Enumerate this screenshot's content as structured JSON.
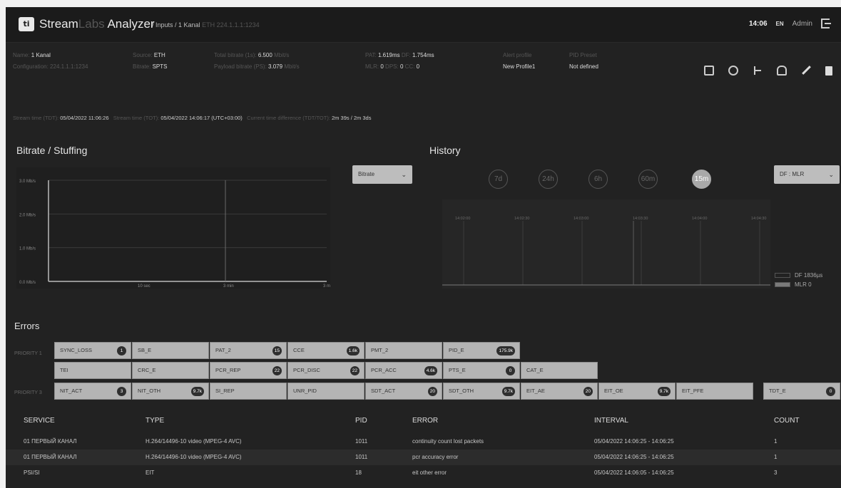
{
  "header": {
    "logo_text": "ti",
    "app_name_1": "Stream",
    "app_name_2": "Labs",
    "app_name_3": " Analyzer",
    "breadcrumb": "/ Inputs / 1 Kanal",
    "breadcrumb_dim": "ETH 224.1.1.1:1234",
    "time": "14:06",
    "lang": "EN",
    "user": "Admin"
  },
  "info": {
    "name_label": "Name:",
    "name_value": "1 Kanal",
    "config_label": "Configuration:",
    "config_value": "224.1.1.1:1234",
    "source_label": "Source:",
    "source_value": "ETH",
    "bitrate_label": "Bitrate:",
    "bitrate_value": "SPTS",
    "total_bitrate_label": "Total bitrate (1s):",
    "total_bitrate_value": "6.500",
    "total_bitrate_unit": "Mbit/s",
    "payload_label": "Payload bitrate (PS):",
    "payload_value": "3.079",
    "payload_unit": "Mbit/s",
    "pat_label": "PAT:",
    "pat_value": "1.619ms",
    "df_label": "DF:",
    "df_value": "1.754ms",
    "mlr_label": "MLR:",
    "mlr_value": "0",
    "dps_label": "DPS:",
    "dps_value": "0",
    "cc_label": "CC:",
    "cc_value": "0",
    "alert_label": "Alert profile",
    "alert_value": "New Profile1",
    "pid_label": "PID Preset",
    "pid_value": "Not defined"
  },
  "stream_line": {
    "t1_label": "Stream time (TDT):",
    "t1_value": "05/04/2022 11:06:26",
    "t2_label": "Stream time (TOT):",
    "t2_value": "05/04/2022 14:06:17 (UTC+03:00)",
    "diff_label": "Current time difference (TDT/TOT):",
    "diff_value": "2m 39s / 2m 3ds"
  },
  "bitrate_panel": {
    "title": "Bitrate / Stuffing",
    "select": "Bitrate"
  },
  "history_panel": {
    "title": "History",
    "ranges": [
      "7d",
      "24h",
      "6h",
      "60m",
      "15m"
    ],
    "active_range": "15m",
    "select": "DF : MLR",
    "legend": [
      {
        "label": "DF 1836µs",
        "color": "#222222"
      },
      {
        "label": "MLR 0",
        "color": "#7a7a7a"
      }
    ]
  },
  "chart_data": [
    {
      "type": "line",
      "y_tick_labels": [
        "3.0 Mb/s",
        "2.0 Mb/s",
        "1.0 Mb/s",
        "0.0 Mb/s"
      ],
      "x_tick_labels": [
        "10 sec",
        "3 min",
        "3 min"
      ],
      "series": [
        {
          "values": []
        }
      ]
    },
    {
      "type": "bar",
      "x_tick_labels": [
        "14:02:00",
        "14:02:30",
        "14:03:00",
        "14:03:30",
        "14:04:00",
        "14:04:30"
      ],
      "series": [
        {
          "name": "DF 1836µs",
          "values": []
        },
        {
          "name": "MLR 0",
          "values": []
        }
      ]
    }
  ],
  "errors": {
    "title": "Errors",
    "row_labels": [
      "PRIORITY 1",
      "",
      "PRIORITY 3"
    ],
    "row1": [
      {
        "label": "SYNC_LOSS",
        "badge": "1"
      },
      {
        "label": "SB_E",
        "badge": ""
      },
      {
        "label": "PAT_2",
        "badge": "15"
      },
      {
        "label": "CCE",
        "badge": "1.6k"
      },
      {
        "label": "PMT_2",
        "badge": ""
      },
      {
        "label": "PID_E",
        "badge": "175.9k"
      }
    ],
    "row2": [
      {
        "label": "TEI",
        "badge": ""
      },
      {
        "label": "CRC_E",
        "badge": ""
      },
      {
        "label": "PCR_REP",
        "badge": "22"
      },
      {
        "label": "PCR_DISC",
        "badge": "22"
      },
      {
        "label": "PCR_ACC",
        "badge": "4.6k"
      },
      {
        "label": "PTS_E",
        "badge": "0"
      },
      {
        "label": "CAT_E",
        "badge": ""
      }
    ],
    "row3": [
      {
        "label": "NIT_ACT",
        "badge": "3"
      },
      {
        "label": "NIT_OTH",
        "badge": "9.7k"
      },
      {
        "label": "SI_REP",
        "badge": ""
      },
      {
        "label": "UNR_PID",
        "badge": ""
      },
      {
        "label": "SDT_ACT",
        "badge": "20"
      },
      {
        "label": "SDT_OTH",
        "badge": "9.7k"
      },
      {
        "label": "EIT_AE",
        "badge": "20"
      },
      {
        "label": "EIT_OE",
        "badge": "9.7k"
      },
      {
        "label": "EIT_PFE",
        "badge": ""
      },
      {
        "label": "TDT_E",
        "badge": "0"
      }
    ]
  },
  "table": {
    "headers": {
      "service": "SERVICE",
      "type": "TYPE",
      "pid": "PID",
      "error": "ERROR",
      "interval": "INTERVAL",
      "count": "COUNT"
    },
    "rows": [
      {
        "service": "01 ПЕРВЫЙ КАНАЛ",
        "type": "H.264/14496-10 video (MPEG-4 AVC)",
        "pid": "1011",
        "error": "continuity count lost packets",
        "interval": "05/04/2022 14:06:25 - 14:06:25",
        "count": "1"
      },
      {
        "service": "01 ПЕРВЫЙ КАНАЛ",
        "type": "H.264/14496-10 video (MPEG-4 AVC)",
        "pid": "1011",
        "error": "pcr accuracy error",
        "interval": "05/04/2022 14:06:25 - 14:06:25",
        "count": "1"
      },
      {
        "service": "PSI/SI",
        "type": "EIT",
        "pid": "18",
        "error": "eit other error",
        "interval": "05/04/2022 14:06:05 - 14:06:25",
        "count": "3"
      }
    ]
  }
}
